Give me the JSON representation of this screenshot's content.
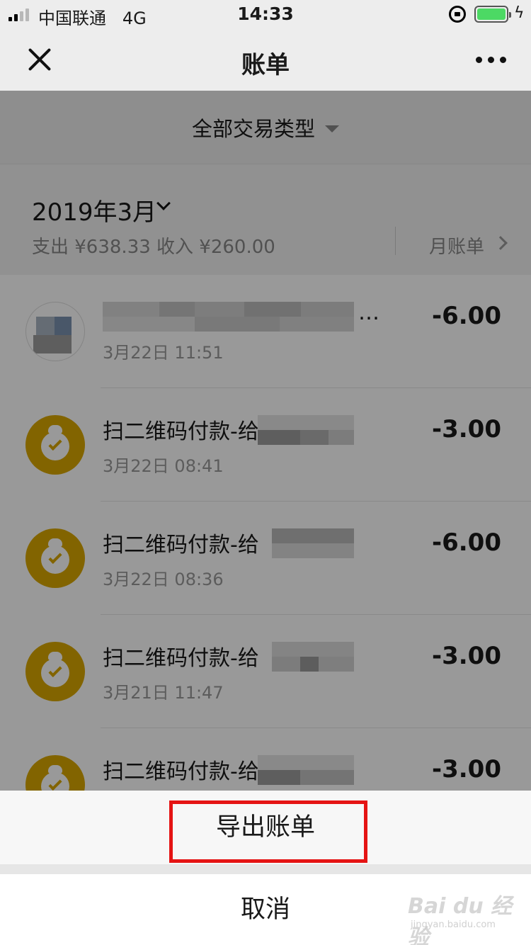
{
  "status_bar": {
    "carrier": "中国联通",
    "network": "4G",
    "time": "14:33",
    "battery_color": "#4cd964"
  },
  "nav": {
    "title": "账单"
  },
  "filter": {
    "label": "全部交易类型"
  },
  "month": {
    "label": "2019年3月",
    "summary": "支出 ¥638.33 收入 ¥260.00",
    "monthly_bill": "月账单"
  },
  "transactions": [
    {
      "title": "…",
      "time": "3月22日 11:51",
      "amount": "-6.00",
      "icon": "avatar-blurred"
    },
    {
      "title": "扫二维码付款-给",
      "time": "3月22日 08:41",
      "amount": "-3.00",
      "icon": "money-bag-icon"
    },
    {
      "title": "扫二维码付款-给",
      "time": "3月22日 08:36",
      "amount": "-6.00",
      "icon": "money-bag-icon"
    },
    {
      "title": "扫二维码付款-给",
      "time": "3月21日 11:47",
      "amount": "-3.00",
      "icon": "money-bag-icon"
    },
    {
      "title": "扫二维码付款-给",
      "time": "",
      "amount": "-3.00",
      "icon": "money-bag-icon"
    }
  ],
  "sheet": {
    "export_label": "导出账单",
    "cancel_label": "取消",
    "highlight_color": "#e51414"
  },
  "watermark": {
    "brand": "Bai du 经验",
    "url": "jingyan.baidu.com"
  }
}
